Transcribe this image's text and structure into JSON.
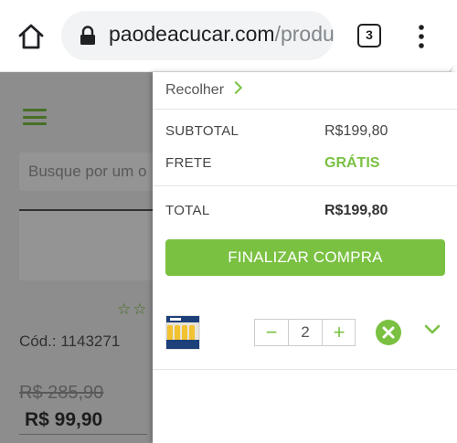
{
  "browser": {
    "url_domain": "paodeacucar.com",
    "url_path": "/produ",
    "tab_count": "3",
    "icons": {
      "home": "home-icon",
      "lock": "lock-icon",
      "menu": "more-vert-icon"
    }
  },
  "page": {
    "search_placeholder": "Busque por um o",
    "product_code": "Cód.: 1143271",
    "old_price": "R$ 285,90",
    "new_price": "R$ 99,90",
    "rating_stars": "☆☆"
  },
  "cart": {
    "collapse_label": "Recolher",
    "subtotal_label": "SUBTOTAL",
    "subtotal_value": "R$199,80",
    "shipping_label": "FRETE",
    "shipping_value": "GRÁTIS",
    "total_label": "TOTAL",
    "total_value": "R$199,80",
    "checkout_label": "FINALIZAR COMPRA",
    "item": {
      "quantity": "2",
      "minus": "−",
      "plus": "+"
    }
  },
  "colors": {
    "accent": "#7ac142",
    "chrome_bg": "#ffffff",
    "urlbar_bg": "#f1f3f4"
  }
}
